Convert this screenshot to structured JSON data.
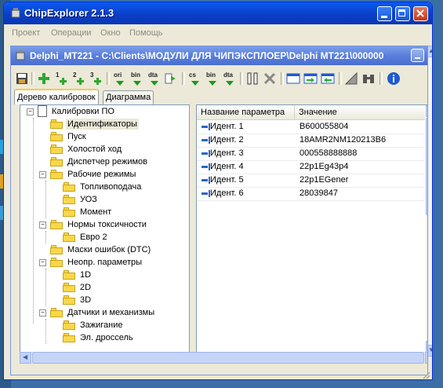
{
  "window": {
    "title": "ChipExplorer 2.1.3",
    "accent": "#0a5bf0"
  },
  "menu": [
    "Проект",
    "Операции",
    "Окно",
    "Помощь"
  ],
  "document": {
    "title": "Delphi_MT221 - C:\\Clients\\МОДУЛИ ДЛЯ ЧИПЭКСПЛОЕР\\Delphi MT221\\000000"
  },
  "toolbar": {
    "buttons": [
      {
        "icon": "save-icon",
        "label": ""
      },
      {
        "icon": "add-icon",
        "label": ""
      },
      {
        "icon": "add-1-icon",
        "label": "1"
      },
      {
        "icon": "add-2-icon",
        "label": "2"
      },
      {
        "icon": "add-3-icon",
        "label": "3"
      },
      {
        "icon": "read-ori-icon",
        "label": "ori"
      },
      {
        "icon": "read-bin-icon",
        "label": "bin"
      },
      {
        "icon": "read-dta-icon",
        "label": "dta"
      },
      {
        "icon": "forward-icon",
        "label": ""
      },
      {
        "icon": "checksum-icon",
        "label": "cs"
      },
      {
        "icon": "write-bin-icon",
        "label": "bin"
      },
      {
        "icon": "write-dta-icon",
        "label": "dta"
      },
      {
        "icon": "compare-icon",
        "label": ""
      },
      {
        "icon": "unlink-icon",
        "label": ""
      },
      {
        "icon": "window-icon",
        "label": ""
      },
      {
        "icon": "window-import-icon",
        "label": ""
      },
      {
        "icon": "window-export-icon",
        "label": ""
      },
      {
        "icon": "ruler-icon",
        "label": ""
      },
      {
        "icon": "binoculars-icon",
        "label": ""
      },
      {
        "icon": "info-icon",
        "label": ""
      }
    ]
  },
  "tabs": [
    {
      "label": "Дерево калибровок",
      "active": true
    },
    {
      "label": "Диаграмма",
      "active": false
    }
  ],
  "tree": {
    "root": "Калибровки ПО",
    "nodes": [
      {
        "label": "Идентификаторы",
        "selected": true
      },
      {
        "label": "Пуск"
      },
      {
        "label": "Холостой ход"
      },
      {
        "label": "Диспетчер режимов"
      },
      {
        "label": "Рабочие режимы"
      },
      {
        "label": "Топливоподача"
      },
      {
        "label": "УОЗ"
      },
      {
        "label": "Момент"
      },
      {
        "label": "Нормы токсичности"
      },
      {
        "label": "Евро 2"
      },
      {
        "label": "Маски ошибок (DTC)"
      },
      {
        "label": "Неопр. параметры"
      },
      {
        "label": "1D"
      },
      {
        "label": "2D"
      },
      {
        "label": "3D"
      },
      {
        "label": "Датчики и механизмы"
      },
      {
        "label": "Зажигание"
      },
      {
        "label": "Эл. дроссель"
      }
    ]
  },
  "grid": {
    "columns": [
      "Название параметра",
      "Значение"
    ],
    "rows": [
      {
        "name": "Идент. 1",
        "value": "B600055804"
      },
      {
        "name": "Идент. 2",
        "value": "18AMR2NM120213B6"
      },
      {
        "name": "Идент. 3",
        "value": "000558888888"
      },
      {
        "name": "Идент. 4",
        "value": "22p1Eg43p4"
      },
      {
        "name": "Идент. 5",
        "value": "22p1EGener"
      },
      {
        "name": "Идент. 6",
        "value": "28039847"
      }
    ]
  }
}
